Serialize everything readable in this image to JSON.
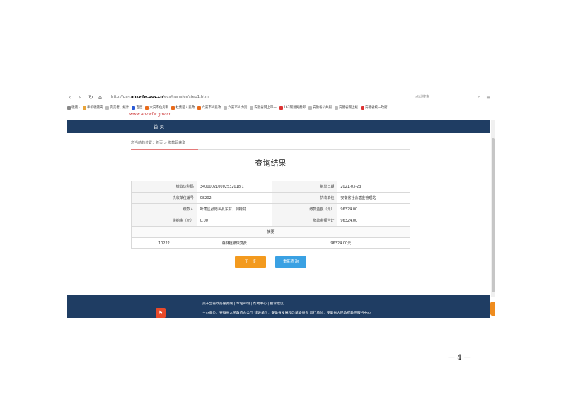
{
  "browser": {
    "nav_icons": [
      "back-icon",
      "forward-icon",
      "refresh-icon",
      "home-icon"
    ],
    "url_prefix": "http://pay.",
    "url_domain": "ahzwfw.gov.cn",
    "url_path": "/ecs/transfer/step1.html",
    "search_placeholder": "点此搜索",
    "bookmarks": [
      {
        "label": "收藏 ·",
        "color": "#888"
      },
      {
        "label": "手机收藏夹",
        "color": "#e8a43a"
      },
      {
        "label": "完美者、统计",
        "color": "#bbb"
      },
      {
        "label": "百度",
        "color": "#2a5bd7"
      },
      {
        "label": "六安市住房和",
        "color": "#e86a1a"
      },
      {
        "label": "杜集区人民政",
        "color": "#e86a1a"
      },
      {
        "label": "六安市人民政",
        "color": "#e86a1a"
      },
      {
        "label": "六安市人力资",
        "color": "#bbb"
      },
      {
        "label": "安徽省网上审一",
        "color": "#bbb"
      },
      {
        "label": "163网易免费邮",
        "color": "#d33"
      },
      {
        "label": "安徽省公共服",
        "color": "#bbb"
      },
      {
        "label": "安徽省网上统",
        "color": "#bbb"
      },
      {
        "label": "安徽省统一政府",
        "color": "#d33"
      }
    ]
  },
  "site": {
    "logo_text": "www.ahzwfw.gov.cn",
    "nav_home": "首 页",
    "breadcrumb": "您当前的位置：首页 > 缴款码获取"
  },
  "result": {
    "title": "查询结果",
    "rows": [
      {
        "label1": "缴款识别码",
        "value1": "340000210002532018l1",
        "label2": "制单日期",
        "value2": "2021-03-23"
      },
      {
        "label1": "执收单位编号",
        "value1": "08202",
        "label2": "执收单位",
        "value2": "安徽省社会基金管理站"
      },
      {
        "label1": "缴款人",
        "value1": "叶集区孙岗乡孔东村、洞槽村",
        "label2": "缴款金额（元）",
        "value2": "96324.00"
      },
      {
        "label1": "滞纳金（元）",
        "value1": "0.00",
        "label2": "缴款金额合计",
        "value2": "96324.00"
      }
    ],
    "detail_header": "摘要",
    "detail_row": {
      "code": "10222",
      "name": "森林植被恢复费",
      "amount": "96324.00元"
    }
  },
  "buttons": {
    "next": "下一步",
    "retry": "重新查询"
  },
  "footer": {
    "links": "关于全省政务服务网  |  本站声明  |  帮助中心  |  投诉建议",
    "info": "主办单位：安徽省人民政府办公厅    建设单位：安徽省发展和改革委员会    运行单位：安徽省人民政府政务服务中心"
  },
  "page_number": "— 4 —"
}
